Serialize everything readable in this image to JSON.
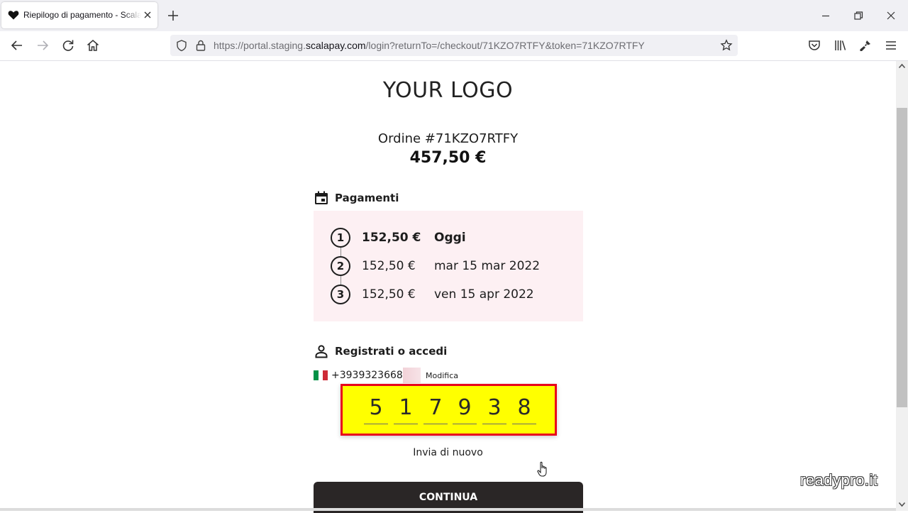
{
  "browser": {
    "tab_title": "Riepilogo di pagamento - Scalapay",
    "url": {
      "prefix": "https://portal.staging.",
      "domain": "scalapay.com",
      "path": "/login?returnTo=/checkout/71KZO7RTFY&token=71KZO7RTFY"
    }
  },
  "page": {
    "logo": "YOUR LOGO",
    "order_label": "Ordine #71KZO7RTFY",
    "total": "457,50 €",
    "payments": {
      "title": "Pagamenti",
      "installments": [
        {
          "number": "1",
          "amount": "152,50 €",
          "date": "Oggi"
        },
        {
          "number": "2",
          "amount": "152,50 €",
          "date": "mar 15 mar 2022"
        },
        {
          "number": "3",
          "amount": "152,50 €",
          "date": "ven 15 apr 2022"
        }
      ]
    },
    "account": {
      "title": "Registrati o accedi",
      "phone": "+3939323668",
      "edit_label": "Modifica",
      "otp_digits": [
        "5",
        "1",
        "7",
        "9",
        "3",
        "8"
      ],
      "resend_label": "Invia di nuovo"
    },
    "continue_label": "CONTINUA",
    "watermark": "readypro.it"
  },
  "colors": {
    "accent_pink": "#fdf0f3",
    "otp_highlight": "#ffff00",
    "otp_border": "#e8001c",
    "button_dark": "#2a2626"
  }
}
